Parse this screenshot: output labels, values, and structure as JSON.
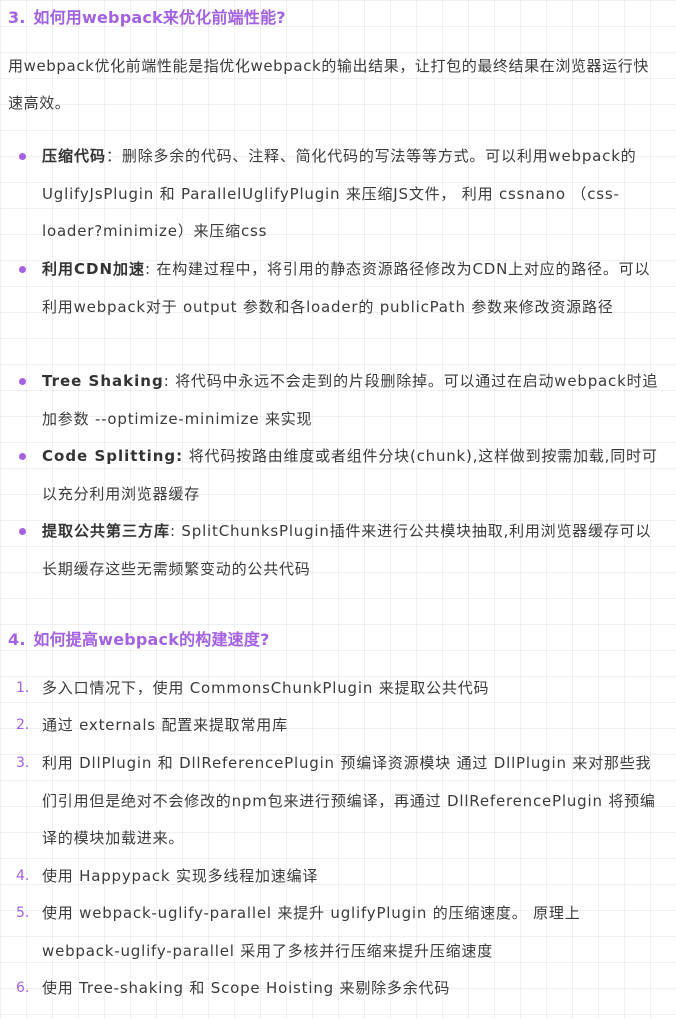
{
  "section3": {
    "number": "3.",
    "title": "如何用webpack来优化前端性能?",
    "intro": "用webpack优化前端性能是指优化webpack的输出结果，让打包的最终结果在浏览器运行快速高效。",
    "items": [
      {
        "term": "压缩代码",
        "text": "：删除多余的代码、注释、简化代码的写法等等方式。可以利用webpack的 UglifyJsPlugin 和 ParallelUglifyPlugin 来压缩JS文件， 利用 cssnano （css-loader?minimize）来压缩css"
      },
      {
        "term": "利用CDN加速",
        "text": ": 在构建过程中，将引用的静态资源路径修改为CDN上对应的路径。可以利用webpack对于 output 参数和各loader的 publicPath 参数来修改资源路径"
      },
      {
        "term": "Tree Shaking",
        "text": ": 将代码中永远不会走到的片段删除掉。可以通过在启动webpack时追加参数 --optimize-minimize 来实现"
      },
      {
        "term": "Code Splitting:",
        "text": " 将代码按路由维度或者组件分块(chunk),这样做到按需加载,同时可以充分利用浏览器缓存"
      },
      {
        "term": "提取公共第三方库",
        "text": ": SplitChunksPlugin插件来进行公共模块抽取,利用浏览器缓存可以长期缓存这些无需频繁变动的公共代码"
      }
    ]
  },
  "section4": {
    "number": "4.",
    "title": "如何提高webpack的构建速度?",
    "items": [
      {
        "num": "1.",
        "text": "多入口情况下，使用 CommonsChunkPlugin 来提取公共代码"
      },
      {
        "num": "2.",
        "text": "通过 externals 配置来提取常用库"
      },
      {
        "num": "3.",
        "text": "利用 DllPlugin 和 DllReferencePlugin 预编译资源模块 通过 DllPlugin 来对那些我们引用但是绝对不会修改的npm包来进行预编译，再通过 DllReferencePlugin 将预编译的模块加载进来。"
      },
      {
        "num": "4.",
        "text": "使用 Happypack 实现多线程加速编译"
      },
      {
        "num": "5.",
        "text": "使用 webpack-uglify-parallel 来提升 uglifyPlugin 的压缩速度。 原理上 webpack-uglify-parallel 采用了多核并行压缩来提升压缩速度"
      },
      {
        "num": "6.",
        "text": "使用 Tree-shaking 和 Scope Hoisting 来剔除多余代码"
      }
    ]
  },
  "colors": {
    "accent": "#a461e3",
    "text": "#3b3b3b"
  }
}
